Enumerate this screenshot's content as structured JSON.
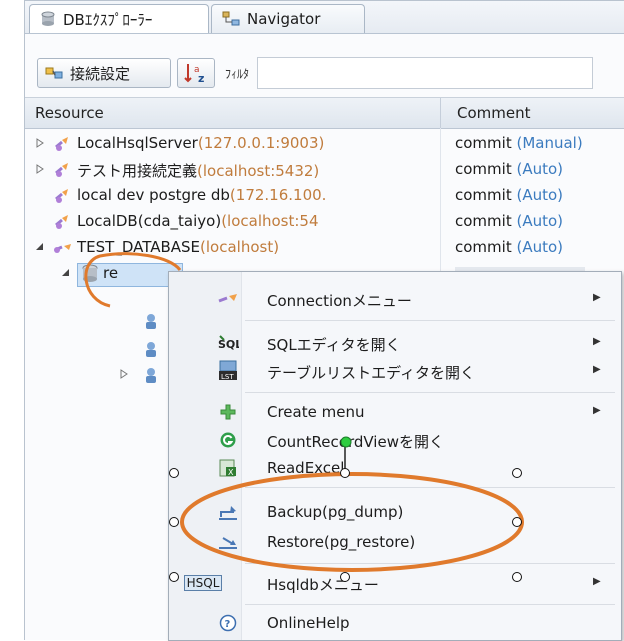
{
  "tabs": [
    {
      "label": "DBｴｸｽﾌﾟﾛｰﾗｰ",
      "active": true
    },
    {
      "label": "Navigator",
      "active": false
    }
  ],
  "toolbar": {
    "connect_label": "接続設定",
    "filter_label": "ﾌｨﾙﾀ",
    "filter_value": ""
  },
  "tree": {
    "columns": [
      "Resource",
      "Comment"
    ],
    "rows": [
      {
        "name": "LocalHsqlServer",
        "host": "(127.0.0.1:9003)",
        "comment": "commit",
        "mode": "(Manual)",
        "expander": "collapsed"
      },
      {
        "name": "テスト用接続定義",
        "host": "(localhost:5432)",
        "comment": "commit",
        "mode": "(Auto)",
        "expander": "collapsed"
      },
      {
        "name": "local dev postgre db",
        "host": "(172.16.100.",
        "comment": "commit",
        "mode": "(Auto)",
        "expander": "none"
      },
      {
        "name": "LocalDB(cda_taiyo)",
        "host": "(localhost:54",
        "comment": "commit",
        "mode": "(Auto)",
        "expander": "none"
      },
      {
        "name": "TEST_DATABASE",
        "host": "(localhost)",
        "comment": "commit",
        "mode": "(Auto)",
        "expander": "expanded"
      },
      {
        "name": "re",
        "host": "",
        "comment": "",
        "mode": "",
        "expander": "expanded"
      }
    ]
  },
  "context_menu": {
    "items": [
      {
        "label": "Connectionメニュー",
        "icon": "connection-icon",
        "submenu": true
      },
      {
        "label": "SQLエディタを開く",
        "icon": "sql-icon",
        "submenu": true
      },
      {
        "label": "テーブルリストエディタを開く",
        "icon": "table-list-icon",
        "submenu": true
      },
      {
        "label": "Create menu",
        "icon": "plus-icon",
        "submenu": true
      },
      {
        "label": "CountRecordViewを開く",
        "icon": "count-icon",
        "submenu": false
      },
      {
        "label": "ReadExcel",
        "icon": "excel-icon",
        "submenu": false
      },
      {
        "label": "Backup(pg_dump)",
        "icon": "backup-icon",
        "submenu": false
      },
      {
        "label": "Restore(pg_restore)",
        "icon": "restore-icon",
        "submenu": false
      },
      {
        "label": "Hsqldbメニュー",
        "icon": "hsqldb-icon",
        "submenu": true,
        "icon_text": "HSQL"
      },
      {
        "label": "OnlineHelp",
        "icon": "help-icon",
        "submenu": false
      }
    ]
  },
  "colors": {
    "host": "#c07c3d",
    "mode": "#3b7bbf",
    "annotation": "#e07a2c"
  }
}
